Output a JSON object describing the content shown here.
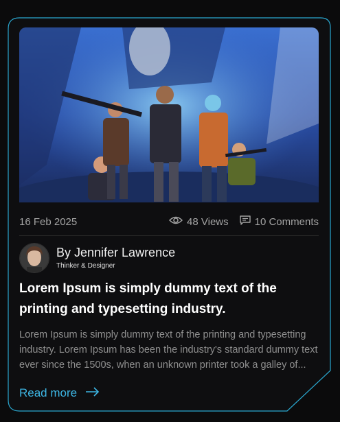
{
  "post": {
    "date": "16 Feb 2025",
    "views": "48 Views",
    "comments": "10 Comments",
    "author_name": "By Jennifer Lawrence",
    "author_role": "Thinker & Designer",
    "title": "Lorem Ipsum is simply dummy text of the printing and typesetting industry.",
    "excerpt": "Lorem Ipsum is simply dummy text of the printing and typesetting industry. Lorem Ipsum has been the industry's standard dummy text ever since the 1500s, when an unknown printer took a galley of...",
    "read_more": "Read more"
  },
  "icons": {
    "views": "eye-icon",
    "comments": "comment-icon",
    "read_more": "arrow-right-icon"
  },
  "colors": {
    "background": "#0b0b0c",
    "card_border": "#2aa8d0",
    "accent": "#3db6e4",
    "muted_text": "#8f8f8f"
  }
}
